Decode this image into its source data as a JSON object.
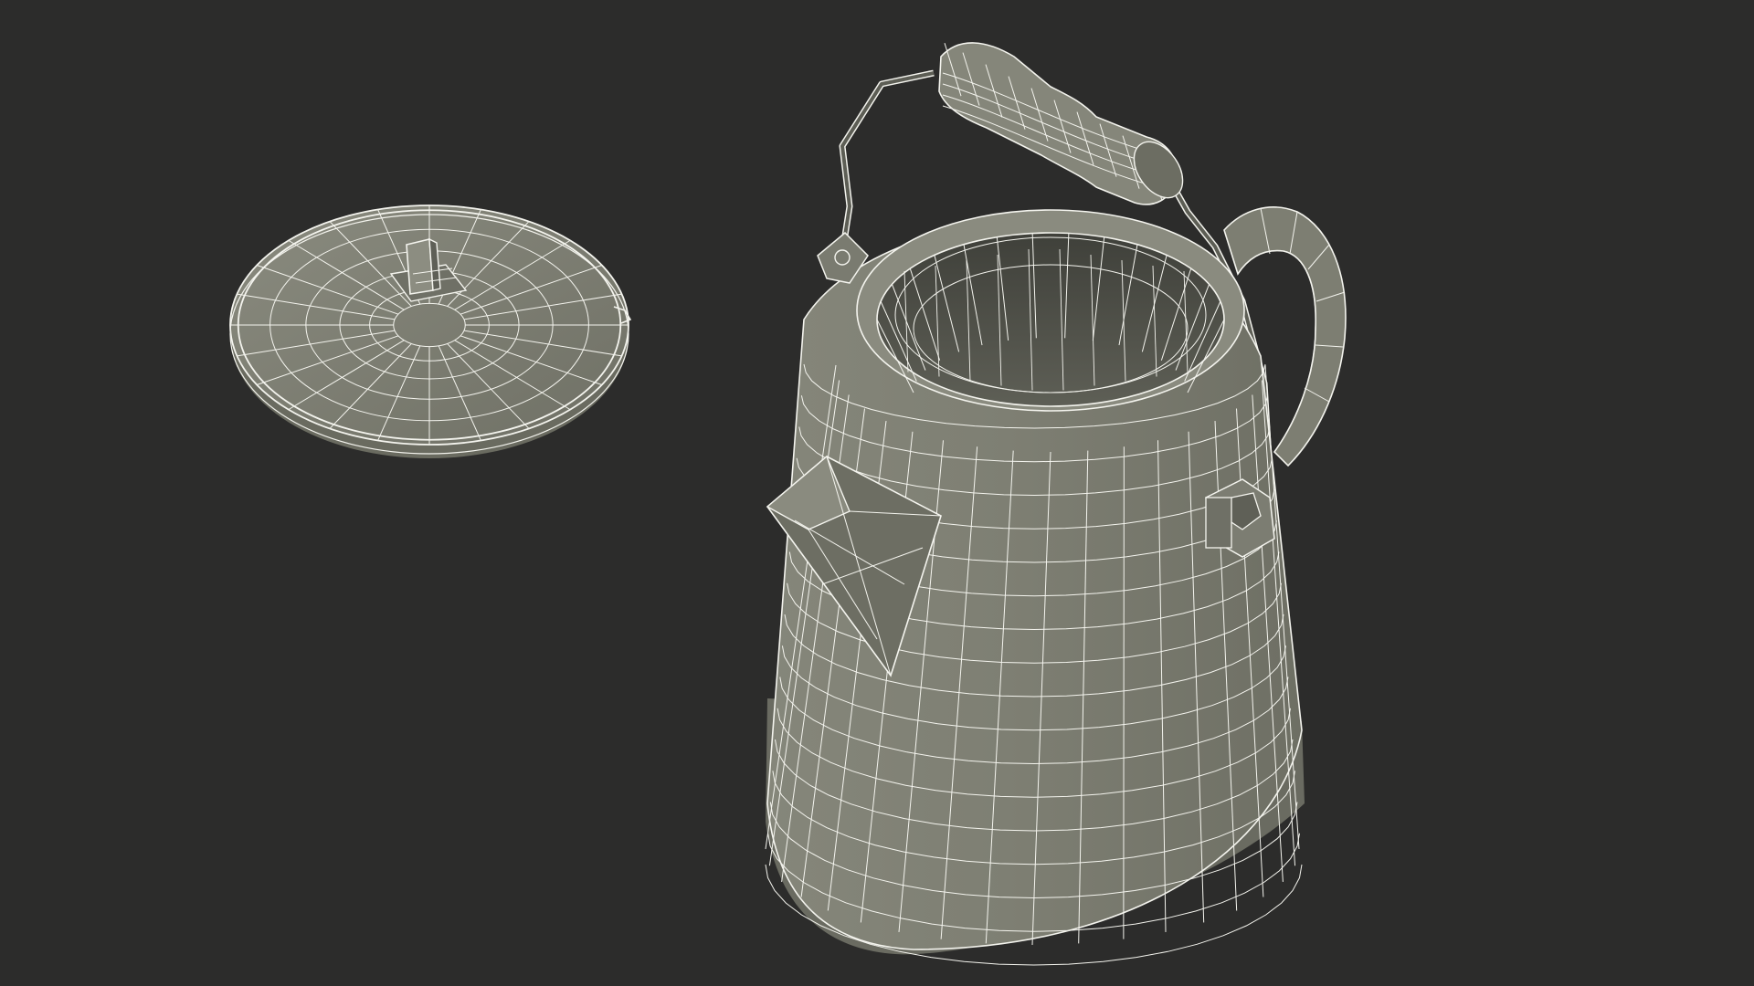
{
  "scene": {
    "description_free": true,
    "background_color": "#2c2c2b",
    "mesh_fill_color": "#7b7c70",
    "mesh_dark_color": "#4e4f47",
    "wire_color": "#f4f4ee",
    "objects": [
      {
        "kind": "lid"
      },
      {
        "kind": "coffee-pot"
      },
      {
        "kind": "bail-handle"
      },
      {
        "kind": "wooden-grip"
      },
      {
        "kind": "side-handle"
      },
      {
        "kind": "spout"
      }
    ]
  }
}
